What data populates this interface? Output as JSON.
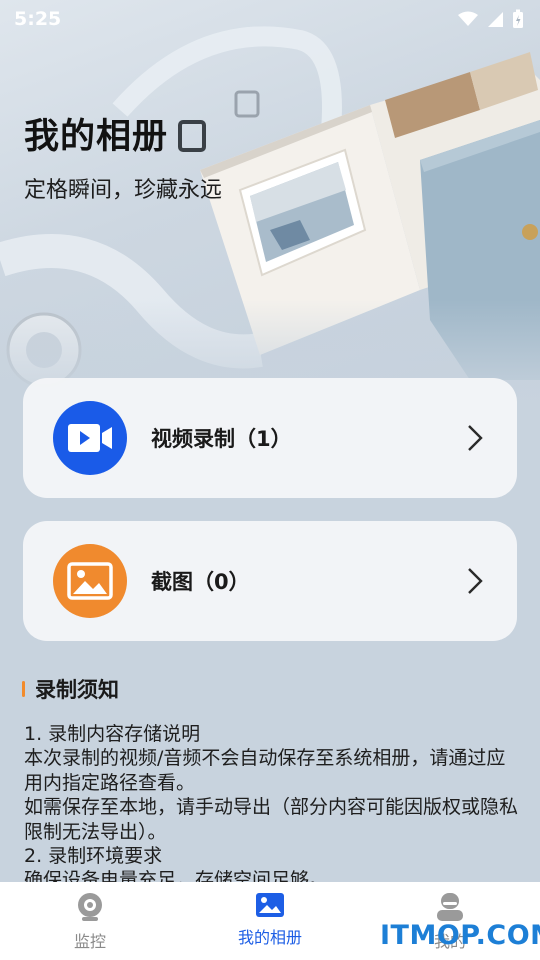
{
  "status": {
    "time": "5:25"
  },
  "header": {
    "title": "我的相册",
    "subtitle": "定格瞬间，珍藏永远"
  },
  "cards": [
    {
      "label": "视频录制（1）",
      "icon": "video-camera-icon",
      "color": "#1a5be8"
    },
    {
      "label": "截图（0）",
      "icon": "image-icon",
      "color": "#f08a2e"
    }
  ],
  "notice": {
    "title": "录制须知",
    "lines": [
      "1. 录制内容存储说明",
      "本次录制的视频/音频不会自动保存至系统相册，请通过应用内指定路径查看。",
      "如需保存至本地，请手动导出（部分内容可能因版权或隐私限制无法导出）。",
      "2. 录制环境要求",
      "确保设备电量充足，存储空间足够。"
    ]
  },
  "tabs": [
    {
      "label": "监控",
      "icon": "camera-icon",
      "active": false
    },
    {
      "label": "我的相册",
      "icon": "photo-album-icon",
      "active": true
    },
    {
      "label": "我的",
      "icon": "user-icon",
      "active": false
    }
  ],
  "watermark": "ITMOP.COM",
  "colors": {
    "accent": "#1d5ee5",
    "notice_bar": "#f28b2c"
  }
}
